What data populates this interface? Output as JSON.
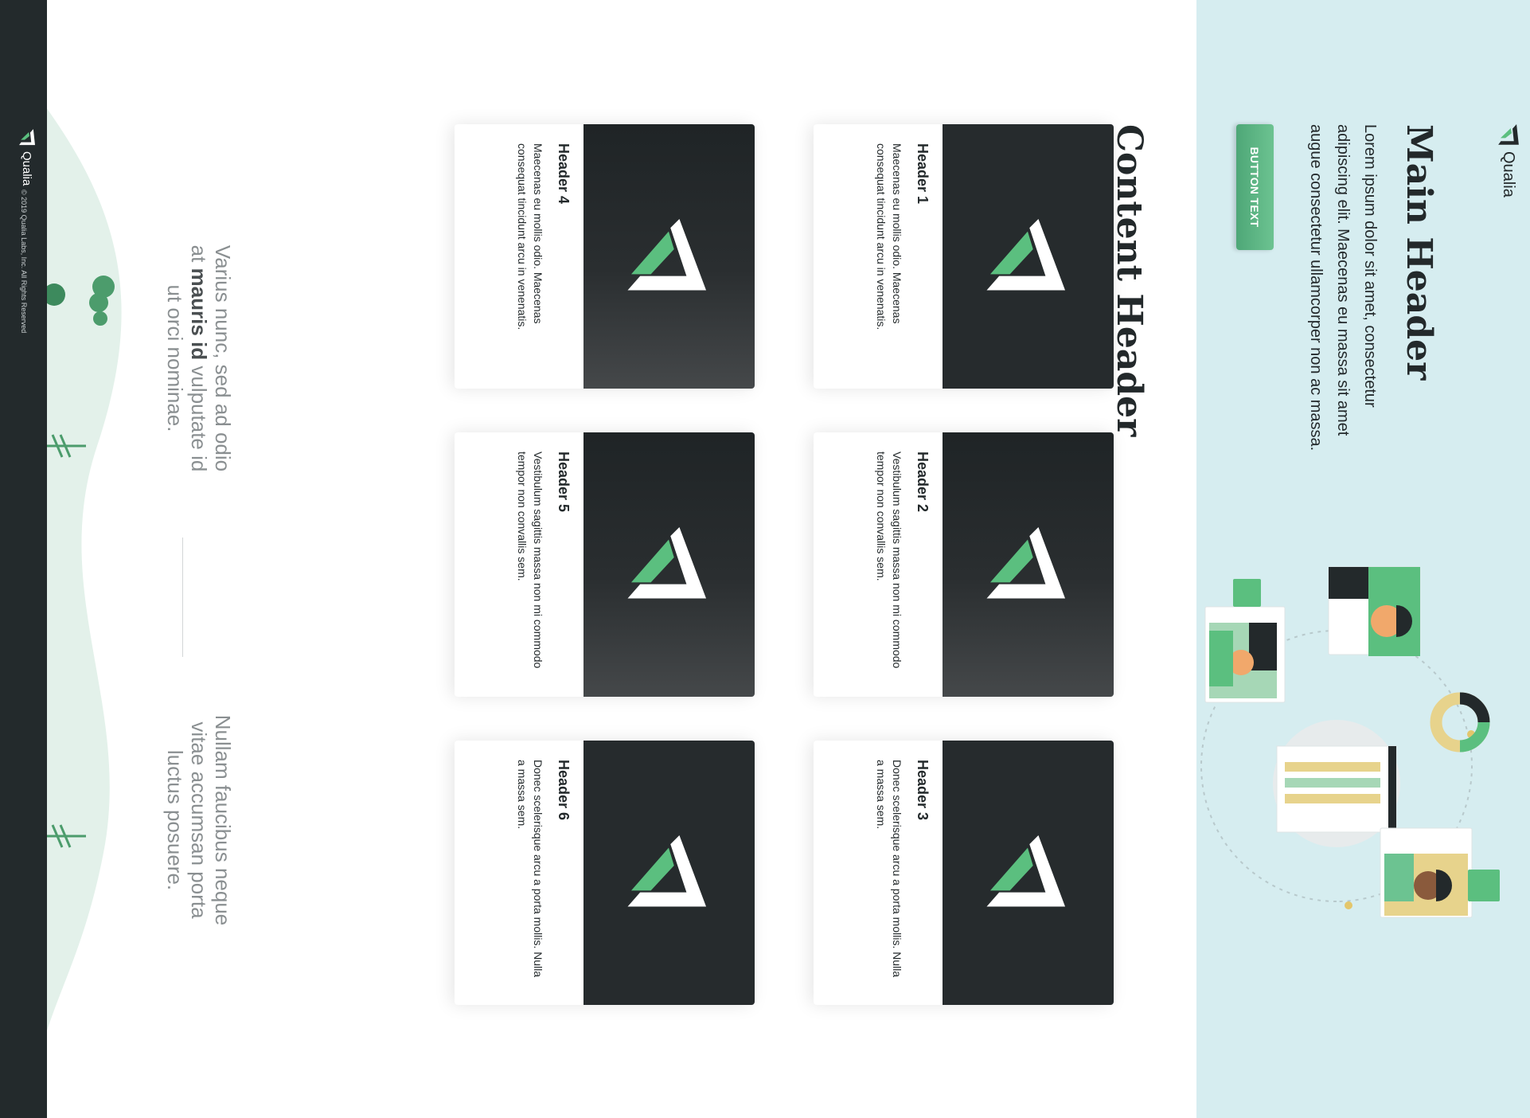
{
  "brand": {
    "name": "Qualia",
    "primary_color": "#5bbf7f",
    "dark_color": "#23292b",
    "hero_bg": "#d6edf0"
  },
  "hero": {
    "logo_text": "Qualia",
    "title": "Main Header",
    "text": "Lorem ipsum dolor sit amet, consectetur adipiscing elit. Maecenas eu massa sit amet augue consectetur ullamcorper non ac massa.",
    "button_label": "BUTTON TEXT",
    "illustration": "team-workflow-illustration"
  },
  "content": {
    "title": "Content Header",
    "cards": [
      {
        "title": "Header 1",
        "text": "Maecenas eu mollis odio. Maecenas consequat tincidunt arcu in venenatis.",
        "media_icon": "qualia-logo-icon"
      },
      {
        "title": "Header 2",
        "text": "Vestibulum sagittis massa non mi commodo tempor non convallis sem.",
        "media_icon": "qualia-logo-icon"
      },
      {
        "title": "Header 3",
        "text": "Donec scelerisque arcu a porta mollis. Nulla a massa sem.",
        "media_icon": "qualia-logo-icon"
      },
      {
        "title": "Header 4",
        "text": "Maecenas eu mollis odio. Maecenas consequat tincidunt arcu in venenatis.",
        "media_icon": "qualia-logo-icon"
      },
      {
        "title": "Header 5",
        "text": "Vestibulum sagittis massa non mi commodo tempor non convallis sem.",
        "media_icon": "qualia-logo-icon"
      },
      {
        "title": "Header 6",
        "text": "Donec scelerisque arcu a porta mollis. Nulla a massa sem.",
        "media_icon": "qualia-logo-icon"
      }
    ]
  },
  "quotes": {
    "left_before": "Varius nunc, sed ad odio at ",
    "left_bold": "mauris id",
    "left_after": " vulputate id ut orci nominae.",
    "right": "Nullam faucibus neque vitae accumsan porta luctus posuere."
  },
  "footer": {
    "logo_text": "Qualia",
    "copyright": "© 2019 Qualia Labs, Inc. All Rights Reserved"
  }
}
